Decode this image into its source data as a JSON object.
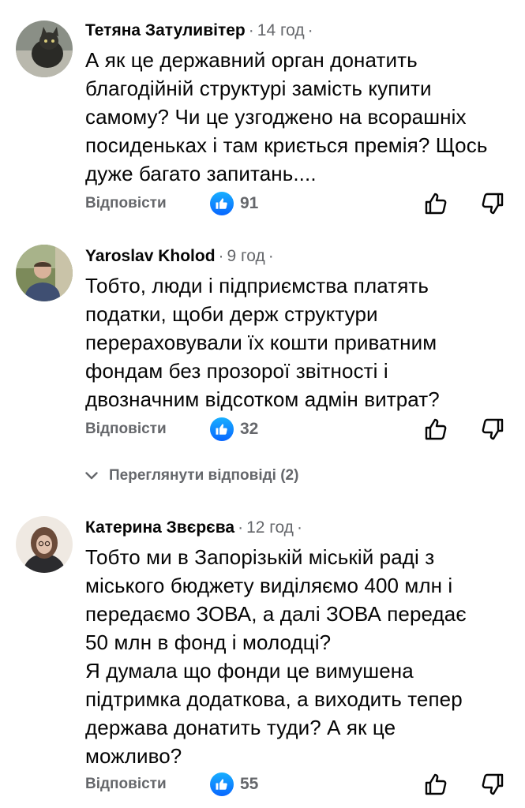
{
  "comments": [
    {
      "author": "Тетяна Затуливітер",
      "time": "14 год",
      "lines": [
        "А як це державний орган донатить",
        "благодійній структурі замість купити",
        "самому? Чи це узгоджено на всорашніх",
        "посиденьках і там криється премія? Щось",
        "дуже багато запитань...."
      ],
      "reply_label": "Відповісти",
      "like_count": "91"
    },
    {
      "author": "Yaroslav Kholod",
      "time": "9 год",
      "lines": [
        "Тобто, люди і підприємства платять",
        "податки, щоби держ структури",
        "перераховували їх кошти приватним",
        "фондам без прозорої звітності і",
        "двозначним відсотком адмін витрат?"
      ],
      "reply_label": "Відповісти",
      "like_count": "32"
    },
    {
      "author": "Катерина Звєрєва",
      "time": "12 год",
      "lines": [
        "Тобто ми в Запорізькій міській раді з",
        "міського бюджету виділяємо 400 млн і",
        "передаємо ЗОВА, а далі ЗОВА передає",
        "50 млн в фонд і молодці?",
        "Я думала що фонди це вимушена",
        "підтримка додаткова, а виходить тепер",
        "держава донатить туди? А як це",
        "можливо?"
      ],
      "reply_label": "Відповісти",
      "like_count": "55"
    }
  ],
  "view_replies_label": "Переглянути відповіді (2)",
  "colors": {
    "text": "#050505",
    "secondary": "#65676b",
    "like_blue": "#0866ff"
  },
  "icons": [
    "like-reaction-icon",
    "thumbs-up-icon",
    "thumbs-down-icon",
    "chevron-down-icon"
  ]
}
